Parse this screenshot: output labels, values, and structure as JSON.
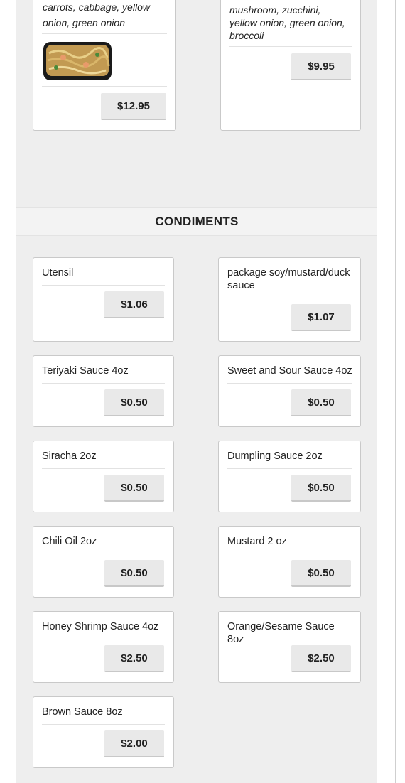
{
  "top_cards": [
    {
      "desc_lines": [
        "carrots, cabbage, yellow",
        "onion, green onion"
      ],
      "price": "$12.95",
      "image": "lo-mein-dish-image"
    },
    {
      "desc_lines": [
        "mushroom, zucchini,",
        "yellow onion, green onion,",
        "broccoli"
      ],
      "price": "$9.95"
    }
  ],
  "section": {
    "title": "CONDIMENTS"
  },
  "items": [
    {
      "name": "Utensil",
      "price": "$1.06"
    },
    {
      "name": "package soy/mustard/duck sauce",
      "price": "$1.07"
    },
    {
      "name": "Teriyaki Sauce 4oz",
      "price": "$0.50"
    },
    {
      "name": "Sweet and Sour Sauce 4oz",
      "price": "$0.50"
    },
    {
      "name": "Siracha 2oz",
      "price": "$0.50"
    },
    {
      "name": "Dumpling Sauce 2oz",
      "price": "$0.50"
    },
    {
      "name": "Chili Oil 2oz",
      "price": "$0.50"
    },
    {
      "name": "Mustard 2 oz",
      "price": "$0.50"
    },
    {
      "name": "Honey Shrimp Sauce 4oz",
      "price": "$2.50"
    },
    {
      "name": "Orange/Sesame Sauce 8oz",
      "price": "$2.50"
    },
    {
      "name": "Brown Sauce 8oz",
      "price": "$2.00"
    }
  ],
  "colors": {
    "panel_bg": "#eeeeee",
    "button_bg": "#e9e9e9",
    "card_border": "#c9c9c9"
  }
}
